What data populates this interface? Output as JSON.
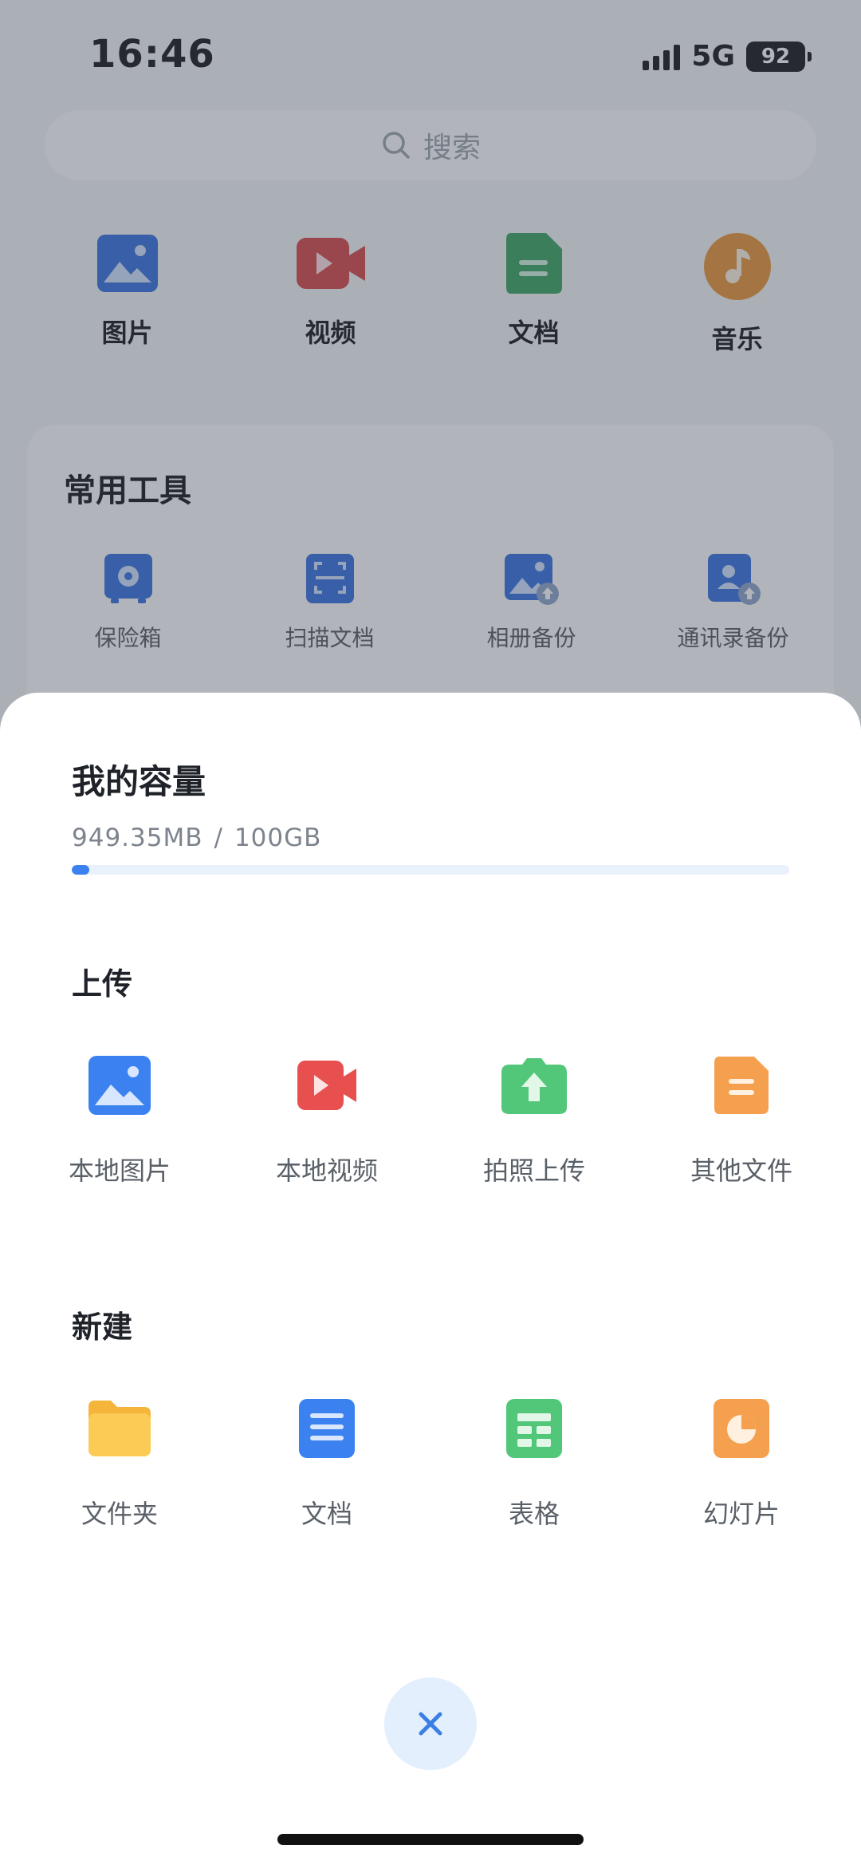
{
  "status": {
    "time": "16:46",
    "network": "5G",
    "battery": "92"
  },
  "search": {
    "placeholder": "搜索"
  },
  "categories": [
    {
      "label": "图片",
      "icon": "image-icon",
      "color": "#2f6bdc"
    },
    {
      "label": "视频",
      "icon": "video-icon",
      "color": "#d64040"
    },
    {
      "label": "文档",
      "icon": "document-icon",
      "color": "#34a05c"
    },
    {
      "label": "音乐",
      "icon": "music-icon",
      "color": "#e9922f"
    }
  ],
  "tools": {
    "title": "常用工具",
    "items": [
      {
        "label": "保险箱",
        "icon": "safe-icon"
      },
      {
        "label": "扫描文档",
        "icon": "scan-icon"
      },
      {
        "label": "相册备份",
        "icon": "album-backup-icon"
      },
      {
        "label": "通讯录备份",
        "icon": "contacts-backup-icon"
      }
    ]
  },
  "sheet": {
    "title": "我的容量",
    "used": "949.35MB",
    "separator": "/",
    "total": "100GB",
    "used_fraction": 0.0093,
    "upload": {
      "title": "上传",
      "items": [
        {
          "label": "本地图片",
          "icon": "local-image-icon",
          "color": "#3b82f0"
        },
        {
          "label": "本地视频",
          "icon": "local-video-icon",
          "color": "#e85050"
        },
        {
          "label": "拍照上传",
          "icon": "camera-upload-icon",
          "color": "#52c77a"
        },
        {
          "label": "其他文件",
          "icon": "other-file-icon",
          "color": "#f5a04e"
        }
      ]
    },
    "create": {
      "title": "新建",
      "items": [
        {
          "label": "文件夹",
          "icon": "folder-icon",
          "color": "#fbc44a"
        },
        {
          "label": "文档",
          "icon": "new-document-icon",
          "color": "#3b82f0"
        },
        {
          "label": "表格",
          "icon": "spreadsheet-icon",
          "color": "#52c77a"
        },
        {
          "label": "幻灯片",
          "icon": "slides-icon",
          "color": "#f5a04e"
        }
      ]
    }
  },
  "close": {
    "icon": "close-icon",
    "color": "#3b7fe6"
  }
}
